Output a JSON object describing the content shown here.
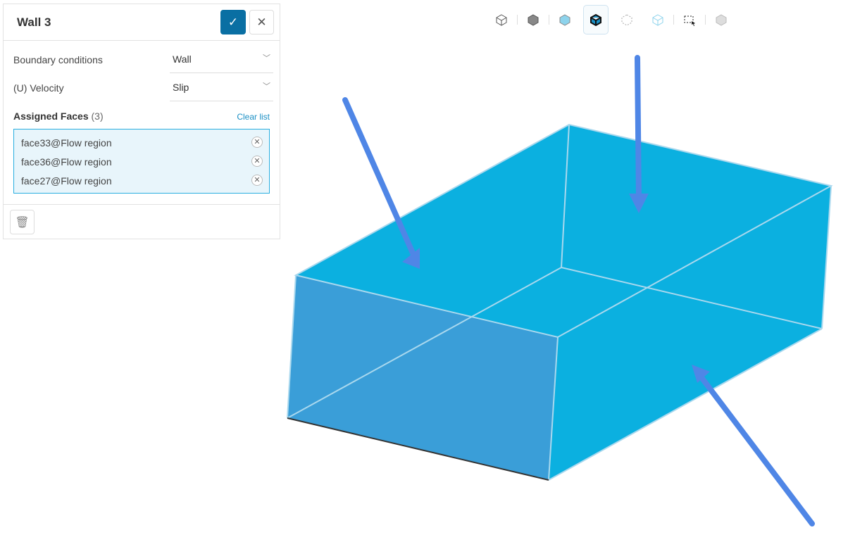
{
  "panel": {
    "title": "Wall 3",
    "confirm_icon": "check-icon",
    "cancel_icon": "close-icon",
    "boundary_label": "Boundary conditions",
    "boundary_value": "Wall",
    "velocity_label": "(U) Velocity",
    "velocity_value": "Slip",
    "assigned_label": "Assigned Faces",
    "assigned_count": "(3)",
    "clear_label": "Clear list",
    "faces": [
      "face33@Flow region",
      "face36@Flow region",
      "face27@Flow region"
    ]
  },
  "toolbar": [
    "wireframe-view-icon",
    "solid-view-icon",
    "transparent-view-icon",
    "solid-edges-view-icon",
    "points-view-icon",
    "edges-view-icon",
    "box-select-icon",
    "hidden-view-icon"
  ],
  "colors": {
    "accent": "#0a6fa3",
    "face_top": "#0bb0e0",
    "face_front": "#3a9ed8",
    "arrow": "#4f86e6"
  }
}
